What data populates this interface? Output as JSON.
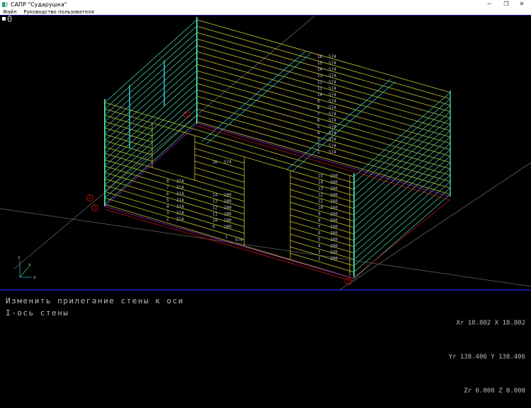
{
  "window": {
    "title": "САПР \"Сударушка\"",
    "minimize": "─",
    "maximize": "❐",
    "close": "✕"
  },
  "menu": {
    "items": [
      {
        "label": "Файл"
      },
      {
        "label": "Руководство пользователя"
      }
    ]
  },
  "viewport": {
    "indicator": "0"
  },
  "status": {
    "line1": "Изменить прилегание стены к оси",
    "line2": "I-ось стены"
  },
  "coords": {
    "xr_label": "Xr",
    "xr": "18.802",
    "x_label": "X",
    "x": "18.802",
    "yr_label": "Yr",
    "yr": "138.406",
    "y_label": "Y",
    "y": "138.406",
    "zr_label": "Zr",
    "zr": "0.000",
    "z_label": "Z",
    "z": "0.000"
  },
  "axes": {
    "x": "x",
    "y": "y",
    "z": "z"
  },
  "markers": [
    "4",
    "1",
    "2",
    "5"
  ],
  "labels": {
    "back_wall": [
      [
        "16",
        "574"
      ],
      [
        "15",
        "574"
      ],
      [
        "14",
        "574"
      ],
      [
        "13",
        "574"
      ],
      [
        "12",
        "574"
      ],
      [
        "11",
        "574"
      ],
      [
        "10",
        "574"
      ],
      [
        "9",
        "574"
      ],
      [
        "8",
        "574"
      ],
      [
        "7",
        "574"
      ],
      [
        "6",
        "574"
      ],
      [
        "5",
        "574"
      ],
      [
        "4",
        "574"
      ],
      [
        "3",
        "574"
      ],
      [
        "2",
        "574"
      ],
      [
        "1",
        "574"
      ]
    ],
    "front_middle": [
      [
        "16",
        "574"
      ],
      [
        "14",
        "100"
      ],
      [
        "13",
        "100"
      ],
      [
        "12",
        "100"
      ],
      [
        "11",
        "100"
      ],
      [
        "10",
        "100"
      ],
      [
        "9",
        "100"
      ]
    ],
    "front_left": [
      [
        "8",
        "314"
      ],
      [
        "7",
        "314"
      ],
      [
        "6",
        "314"
      ],
      [
        "5",
        "314"
      ],
      [
        "4",
        "314"
      ],
      [
        "3",
        "314"
      ],
      [
        "2",
        "314"
      ]
    ],
    "front_bottom": [
      "1",
      "574"
    ],
    "front_right": [
      [
        "15",
        "160"
      ],
      [
        "14",
        "160"
      ],
      [
        "13",
        "160"
      ],
      [
        "12",
        "160"
      ],
      [
        "11",
        "160"
      ],
      [
        "10",
        "160"
      ],
      [
        "9",
        "160"
      ],
      [
        "8",
        "160"
      ],
      [
        "7",
        "160"
      ],
      [
        "6",
        "160"
      ],
      [
        "5",
        "160"
      ],
      [
        "4",
        "160"
      ],
      [
        "3",
        "160"
      ],
      [
        "2",
        "160"
      ]
    ]
  },
  "colors": {
    "log": "#c8c832",
    "side": "#3ccca0",
    "beam": "#30c8c8",
    "base_red": "#c01010",
    "base_purple": "#a020c0",
    "axis": "#666666"
  }
}
